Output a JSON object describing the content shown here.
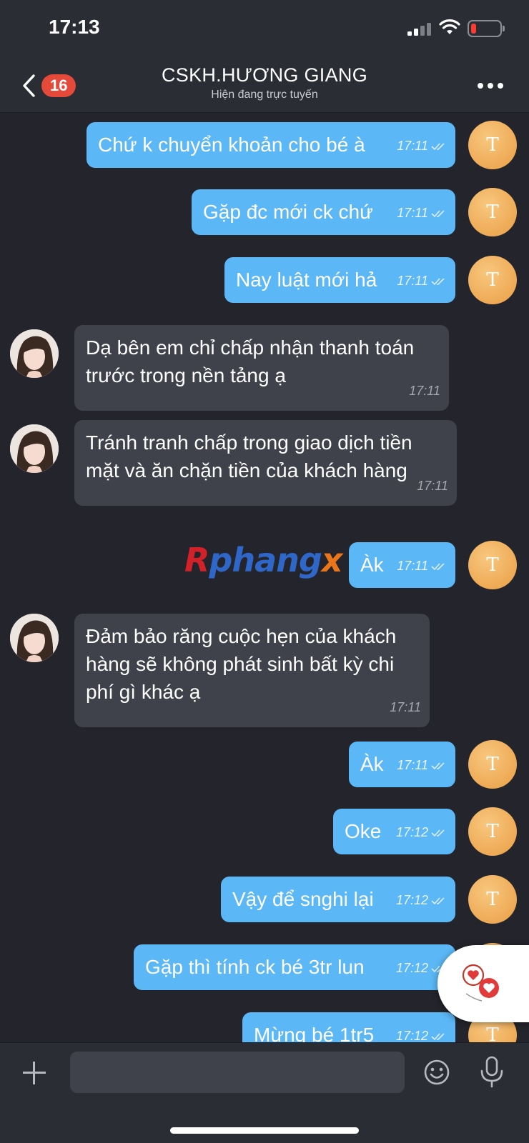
{
  "status_bar": {
    "time": "17:13"
  },
  "header": {
    "unread_count": "16",
    "title": "CSKH.HƯƠNG GIANG",
    "subtitle": "Hiện đang trực tuyến"
  },
  "avatars": {
    "self_initial": "T"
  },
  "messages": [
    {
      "dir": "out",
      "text": "Chứ k chuyển khoản cho bé à",
      "time": "17:11"
    },
    {
      "dir": "out",
      "text": "Gặp đc mới ck chứ",
      "time": "17:11"
    },
    {
      "dir": "out",
      "text": "Nay luật mới hả",
      "time": "17:11"
    },
    {
      "dir": "in",
      "text": "Dạ bên em chỉ chấp nhận thanh toán trước trong nền tảng ạ",
      "time": "17:11"
    },
    {
      "dir": "in",
      "text": "Tránh tranh chấp trong  giao dịch tiền mặt và ăn chặn tiền của khách hàng",
      "time": "17:11"
    },
    {
      "dir": "out",
      "text": "Àk",
      "time": "17:11"
    },
    {
      "dir": "in",
      "text": "Đảm bảo răng cuộc hẹn của khách hàng sẽ không phát sinh bất kỳ chi phí gì khác ạ",
      "time": "17:11"
    },
    {
      "dir": "out",
      "text": "Àk",
      "time": "17:11"
    },
    {
      "dir": "out",
      "text": "Oke",
      "time": "17:12"
    },
    {
      "dir": "out",
      "text": "Vậy để snghi lại",
      "time": "17:12"
    },
    {
      "dir": "out",
      "text": "Gặp thì tính ck bé 3tr lun",
      "time": "17:12"
    },
    {
      "dir": "out",
      "text": "Mừng bé 1tr5",
      "time": "17:12"
    }
  ],
  "watermark": {
    "first": "R",
    "middle": "phang",
    "last": "x"
  },
  "input": {
    "placeholder": "",
    "value": ""
  },
  "icons": {
    "back": "chevron-left-icon",
    "more": "more-dots-icon",
    "plus": "plus-icon",
    "emoji": "emoji-icon",
    "mic": "mic-icon",
    "read": "double-check-icon",
    "floating": "chat-hearts-icon"
  },
  "colors": {
    "outgoing_bubble": "#5bb7f5",
    "incoming_bubble": "#3f414b",
    "background": "#24252c",
    "header": "#2b2d35",
    "badge": "#e5493a",
    "self_avatar": "#eeaa55"
  }
}
